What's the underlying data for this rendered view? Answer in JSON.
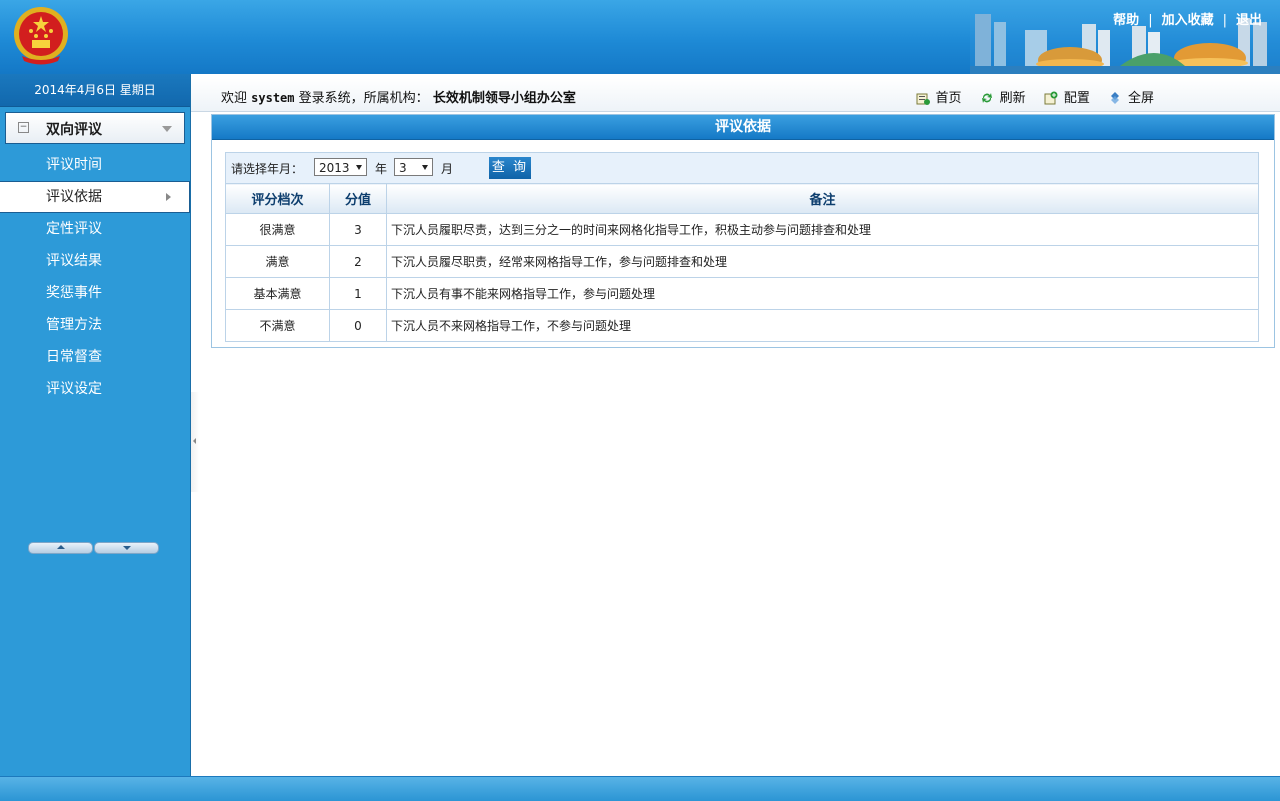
{
  "header": {
    "links": [
      "帮助",
      "加入收藏",
      "退出"
    ],
    "brand_color": "#1e8ad6"
  },
  "sidebar": {
    "date": "2014年4月6日 星期日",
    "menu_title": "双向评议",
    "items": [
      {
        "label": "评议时间",
        "active": false
      },
      {
        "label": "评议依据",
        "active": true
      },
      {
        "label": "定性评议",
        "active": false
      },
      {
        "label": "评议结果",
        "active": false
      },
      {
        "label": "奖惩事件",
        "active": false
      },
      {
        "label": "管理方法",
        "active": false
      },
      {
        "label": "日常督查",
        "active": false
      },
      {
        "label": "评议设定",
        "active": false
      }
    ]
  },
  "infobar": {
    "welcome_prefix": "欢迎",
    "user": "system",
    "welcome_mid": "登录系统，所属机构：",
    "org": "长效机制领导小组办公室",
    "tools": [
      {
        "label": "首页",
        "icon": "home-icon"
      },
      {
        "label": "刷新",
        "icon": "refresh-icon"
      },
      {
        "label": "配置",
        "icon": "config-icon"
      },
      {
        "label": "全屏",
        "icon": "fullscreen-icon"
      }
    ]
  },
  "panel": {
    "title": "评议依据",
    "query": {
      "label": "请选择年月：",
      "year": "2013",
      "year_unit": "年",
      "month": "3",
      "month_unit": "月",
      "button": "查 询"
    },
    "table": {
      "headers": [
        "评分档次",
        "分值",
        "备注"
      ],
      "rows": [
        [
          "很满意",
          "3",
          "下沉人员履职尽责，达到三分之一的时间来网格化指导工作，积极主动参与问题排查和处理"
        ],
        [
          "满意",
          "2",
          "下沉人员履尽职责，经常来网格指导工作，参与问题排查和处理"
        ],
        [
          "基本满意",
          "1",
          "下沉人员有事不能来网格指导工作，参与问题处理"
        ],
        [
          "不满意",
          "0",
          "下沉人员不来网格指导工作，不参与问题处理"
        ]
      ]
    }
  }
}
